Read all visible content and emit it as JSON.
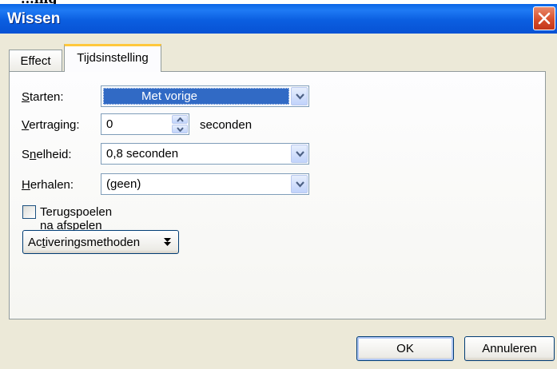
{
  "crop_text": "...ing",
  "window": {
    "title": "Wissen"
  },
  "tabs": [
    {
      "label": "Effect",
      "active": false
    },
    {
      "label": "Tijdsinstelling",
      "active": true
    }
  ],
  "form": {
    "start": {
      "label_pre": "",
      "label_mn": "S",
      "label_post": "tarten:",
      "value": "Met vorige"
    },
    "delay": {
      "label_pre": "",
      "label_mn": "V",
      "label_post": "ertraging:",
      "value": "0",
      "unit": "seconden"
    },
    "speed": {
      "label_pre": "S",
      "label_mn": "n",
      "label_post": "elheid:",
      "value": "0,8 seconden"
    },
    "repeat": {
      "label_pre": "",
      "label_mn": "H",
      "label_post": "erhalen:",
      "value": "(geen)"
    },
    "rewind": {
      "label_pre": "Teru",
      "label_mn": "g",
      "label_post": "spoelen na afspelen",
      "checked": false
    },
    "triggers": {
      "label_pre": "Ac",
      "label_mn": "t",
      "label_post": "iveringsmethoden"
    }
  },
  "buttons": {
    "ok": "OK",
    "cancel": "Annuleren"
  },
  "colors": {
    "titlebar": "#0a5fe0",
    "selection": "#316ac5",
    "tab_highlight": "#ffc83c",
    "close": "#d54b28"
  }
}
